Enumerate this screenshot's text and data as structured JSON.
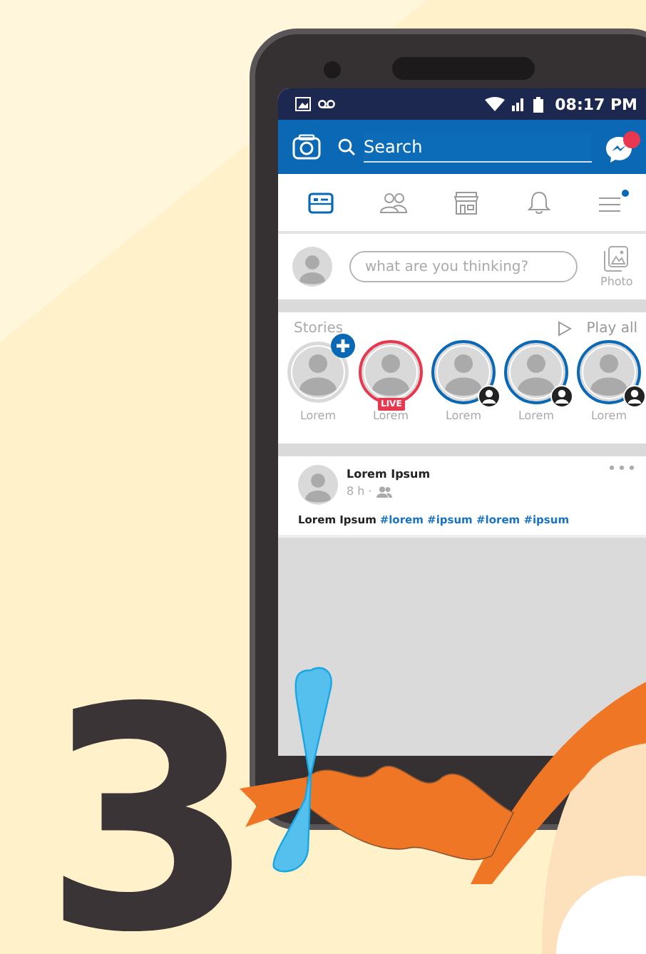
{
  "status_bar": {
    "time": "08:17 PM"
  },
  "header": {
    "search_placeholder": "Search"
  },
  "nav_tabs": [
    {
      "kind": "feed",
      "selected": true,
      "dot": false
    },
    {
      "kind": "friends",
      "selected": false,
      "dot": false
    },
    {
      "kind": "market",
      "selected": false,
      "dot": false
    },
    {
      "kind": "bell",
      "selected": false,
      "dot": false
    },
    {
      "kind": "menu",
      "selected": false,
      "dot": true
    }
  ],
  "composer": {
    "placeholder": "what are you thinking?",
    "photo_label": "Photo"
  },
  "stories": {
    "title": "Stories",
    "play_all": "Play all",
    "items": [
      {
        "kind": "add",
        "name": "Lorem"
      },
      {
        "kind": "live",
        "name": "Lorem",
        "badge": "LIVE"
      },
      {
        "kind": "story",
        "name": "Lorem"
      },
      {
        "kind": "story",
        "name": "Lorem"
      },
      {
        "kind": "story",
        "name": "Lorem"
      }
    ]
  },
  "post": {
    "author": "Lorem Ipsum",
    "time": "8 h ·",
    "text": "Lorem Ipsum",
    "hashtags": "#lorem #ipsum #lorem #ipsum"
  },
  "step_number": "3"
}
